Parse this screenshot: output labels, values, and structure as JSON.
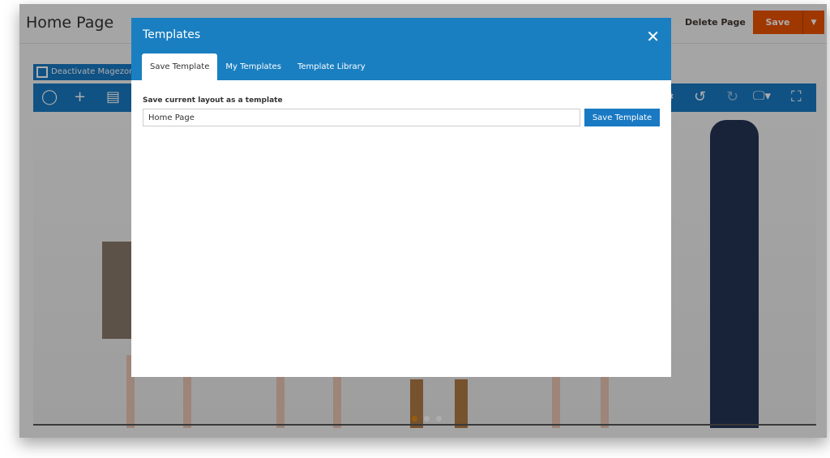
{
  "page": {
    "title": "Home Page",
    "delete_label": "Delete Page",
    "save_label": "Save",
    "deactivate_label": "Deactivate Magezon"
  },
  "modal": {
    "title": "Templates",
    "tabs": [
      {
        "label": "Save Template",
        "active": true
      },
      {
        "label": "My Templates"
      },
      {
        "label": "Template Library"
      }
    ],
    "field_label": "Save current layout as a template",
    "input_value": "Home Page",
    "save_button": "Save Template"
  },
  "colors": {
    "primary": "#1979c3",
    "save": "#eb5202"
  }
}
